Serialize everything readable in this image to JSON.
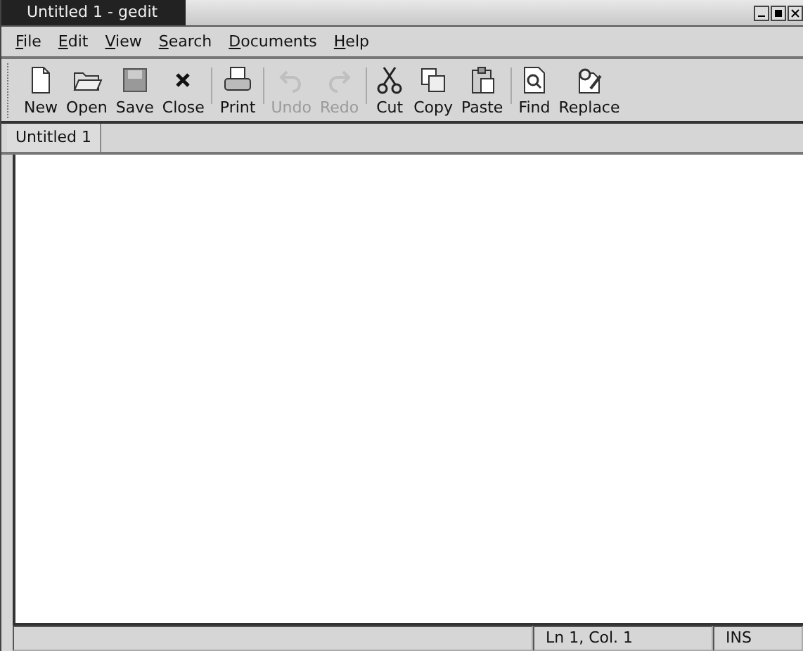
{
  "window": {
    "title": "Untitled 1 - gedit"
  },
  "menu": [
    "File",
    "Edit",
    "View",
    "Search",
    "Documents",
    "Help"
  ],
  "toolbar": [
    {
      "kind": "new",
      "label": "New",
      "disabled": false,
      "separator_after": false
    },
    {
      "kind": "open",
      "label": "Open",
      "disabled": false,
      "separator_after": false
    },
    {
      "kind": "save",
      "label": "Save",
      "disabled": false,
      "separator_after": false
    },
    {
      "kind": "close",
      "label": "Close",
      "disabled": false,
      "separator_after": true
    },
    {
      "kind": "print",
      "label": "Print",
      "disabled": false,
      "separator_after": true
    },
    {
      "kind": "undo",
      "label": "Undo",
      "disabled": true,
      "separator_after": false
    },
    {
      "kind": "redo",
      "label": "Redo",
      "disabled": true,
      "separator_after": true
    },
    {
      "kind": "cut",
      "label": "Cut",
      "disabled": false,
      "separator_after": false
    },
    {
      "kind": "copy",
      "label": "Copy",
      "disabled": false,
      "separator_after": false
    },
    {
      "kind": "paste",
      "label": "Paste",
      "disabled": false,
      "separator_after": true
    },
    {
      "kind": "find",
      "label": "Find",
      "disabled": false,
      "separator_after": false
    },
    {
      "kind": "replace",
      "label": "Replace",
      "disabled": false,
      "separator_after": false
    }
  ],
  "tabs": [
    {
      "label": "Untitled 1",
      "selected": true
    }
  ],
  "status_bar": {
    "position": "Ln 1, Col. 1",
    "mode": "INS"
  }
}
